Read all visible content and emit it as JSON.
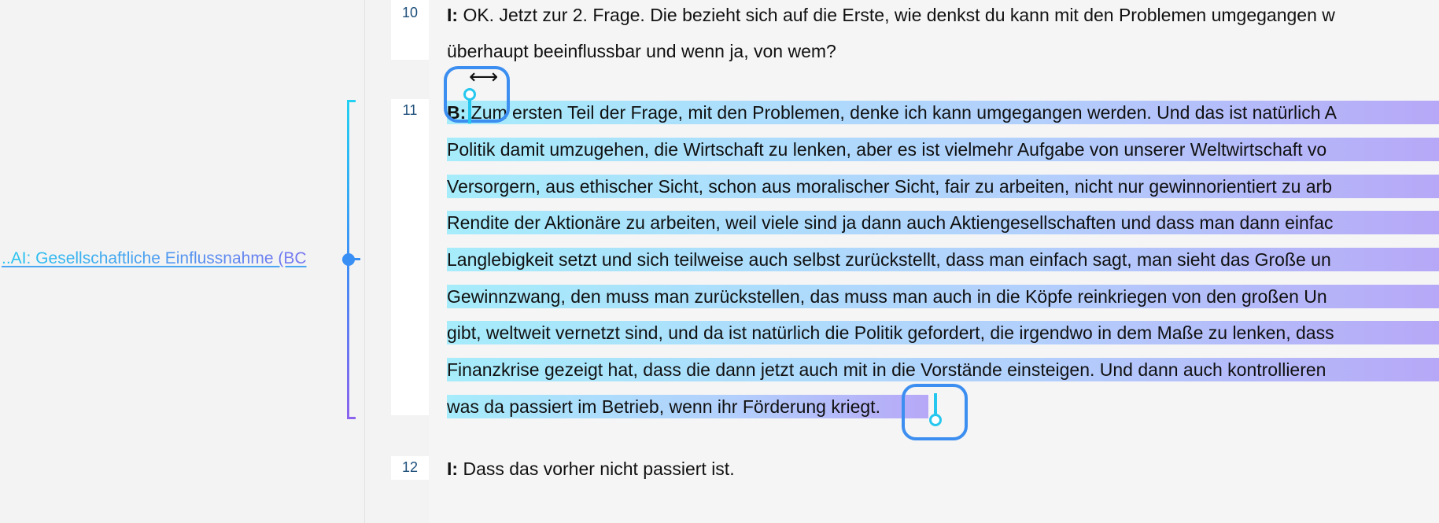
{
  "left_panel": {
    "code_label": "..AI: Gesellschaftliche Einflussnahme (BC"
  },
  "line_numbers": [
    "10",
    "11",
    "12"
  ],
  "paragraphs": {
    "p10": {
      "speaker": "I:",
      "lines": [
        "OK. Jetzt zur 2. Frage. Die bezieht sich auf die Erste, wie denkst du kann mit den Problemen umgegangen w",
        "überhaupt beeinflussbar und wenn ja, von wem?"
      ]
    },
    "p11": {
      "speaker": "B:",
      "lines": [
        "Zum ersten Teil der Frage, mit den Problemen, denke ich kann umgegangen werden. Und das ist natürlich A",
        "Politik damit umzugehen, die Wirtschaft zu lenken, aber es ist vielmehr Aufgabe von unserer Weltwirtschaft vo",
        "Versorgern, aus ethischer Sicht, schon aus moralischer Sicht, fair zu arbeiten, nicht nur gewinnorientiert zu arb",
        "Rendite der Aktionäre zu arbeiten, weil viele sind ja dann auch Aktiengesellschaften und dass man dann einfac",
        "Langlebigkeit setzt und sich teilweise auch selbst zurückstellt, dass man einfach sagt, man sieht das Große un",
        "Gewinnzwang, den muss man zurückstellen, das muss man auch in die Köpfe reinkriegen von den großen Un",
        "gibt, weltweit vernetzt sind, und da ist natürlich die Politik gefordert, die irgendwo in dem Maße zu lenken, dass",
        "Finanzkrise gezeigt hat, dass die dann jetzt auch mit in die Vorstände einsteigen. Und dann auch kontrollieren",
        "was da passiert im Betrieb, wenn ihr Förderung kriegt."
      ]
    },
    "p12": {
      "speaker": "I:",
      "lines": [
        "Dass das vorher nicht passiert ist."
      ]
    }
  },
  "icons": {
    "resize_cursor": "horizontal-resize-cursor-icon",
    "selection_handle": "selection-handle-icon"
  },
  "colors": {
    "highlight_start": "#a6ecfb",
    "highlight_end": "#b6a8f7",
    "handle_accent": "#26c7ee",
    "handle_frame": "#3c8ef0"
  }
}
